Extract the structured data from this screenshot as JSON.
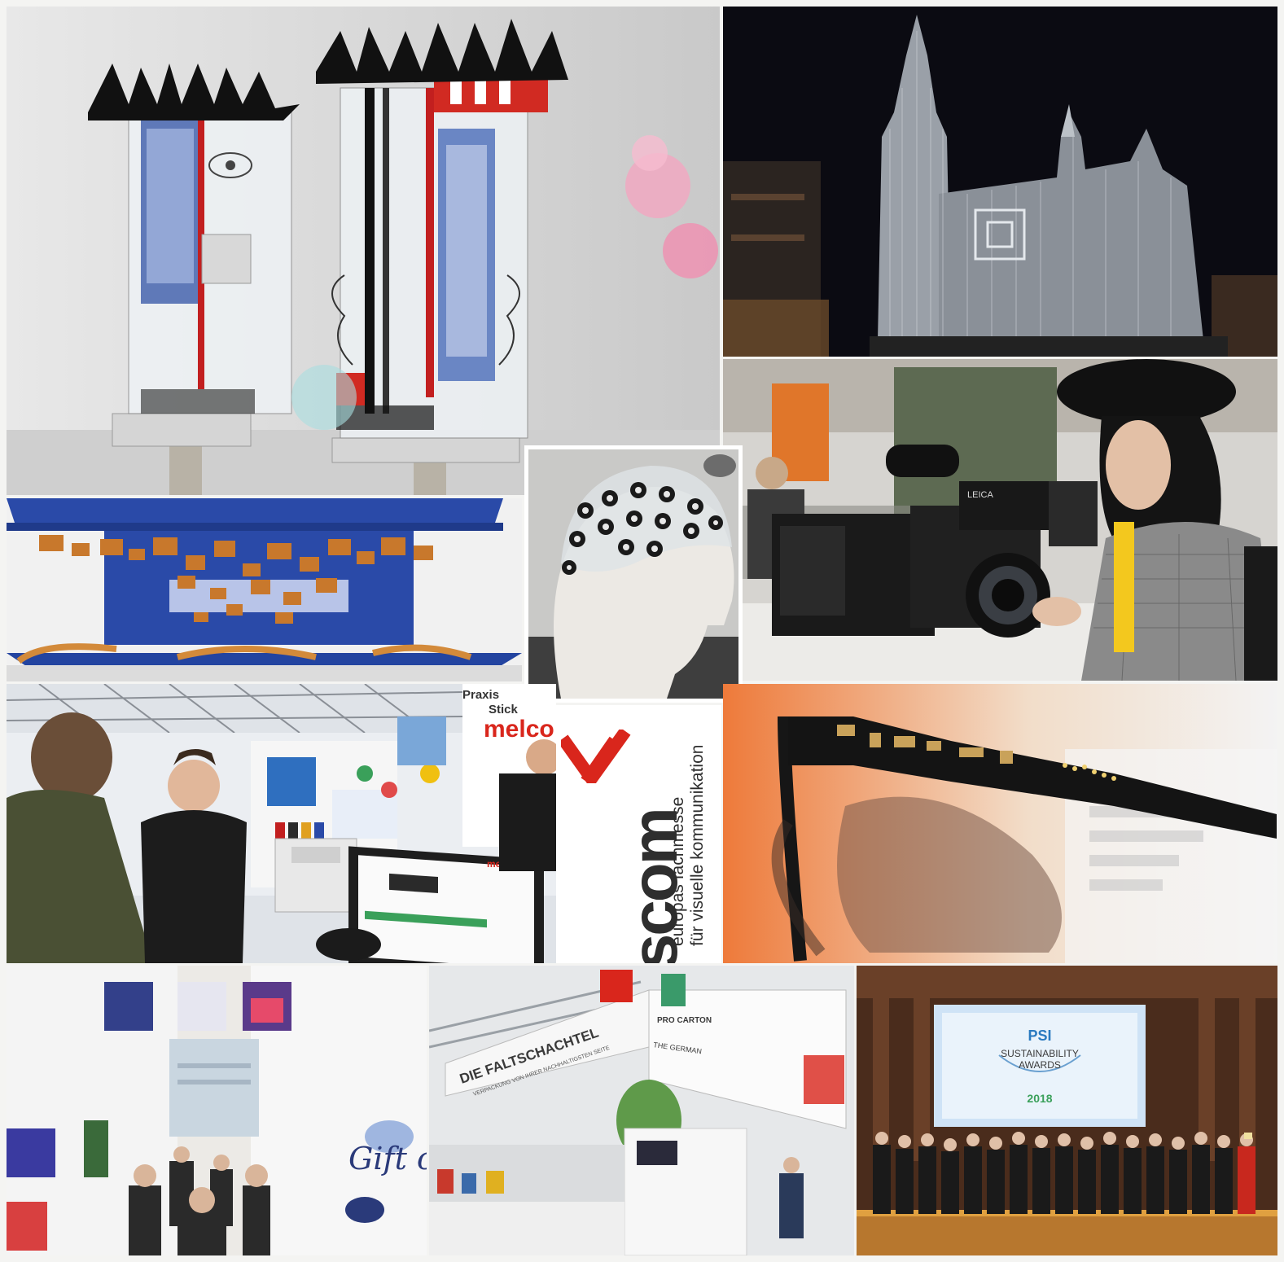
{
  "viscom_logo": {
    "brand": "viscom",
    "tagline_line1": "europas fachmesse",
    "tagline_line2": "für visuelle kommunikation",
    "brand_color": "#d9261c"
  },
  "embroidery_booth": {
    "brand_sign": "melco",
    "monitor_brand": "melco",
    "corner_sign_line1": "Praxis",
    "corner_sign_line2": "Stick"
  },
  "camera_photo": {
    "camera_brand": "LEICA"
  },
  "packaging_booth": {
    "banner_text": "DIE FALTSCHACHTEL",
    "banner_subtext": "VERPACKUNG VON IHRER NACHHALTIGSTEN SEITE",
    "logo_text": "PRO CARTON",
    "side_text": "THE GERMAN"
  },
  "gift_wall": {
    "script_text": "Gift of life"
  },
  "awards_screen": {
    "logo_text": "PSI",
    "title_line1": "SUSTAINABILITY",
    "title_line2": "AWARDS",
    "year": "2018"
  },
  "colors": {
    "accent_red": "#d9261c",
    "booth_blue": "#2a4aa8",
    "night_sky": "#0b0b12"
  }
}
